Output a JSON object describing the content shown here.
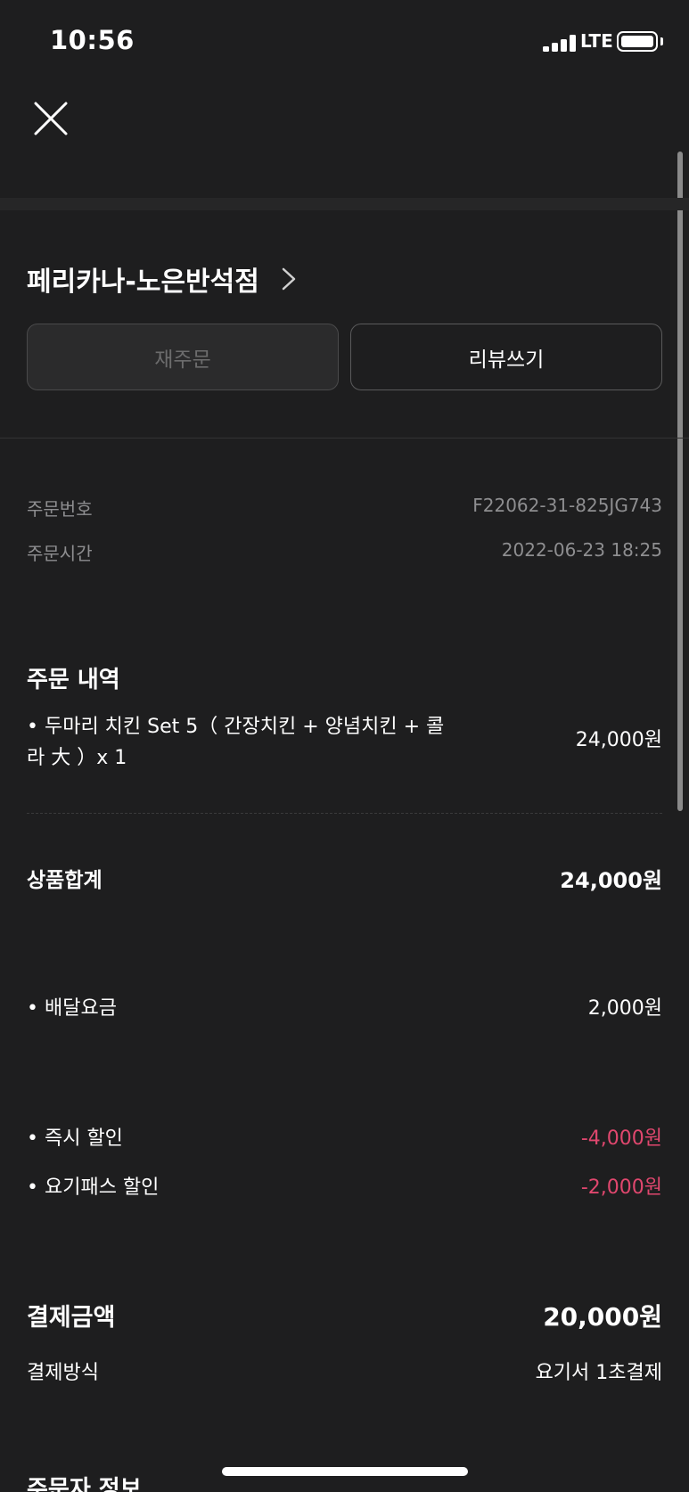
{
  "status_bar": {
    "time": "10:56",
    "network": "LTE",
    "signal_level": 4,
    "battery_level": 1.0
  },
  "icons": {
    "close": "close-icon",
    "chevron": "chevron-right-icon"
  },
  "store": {
    "name": "페리카나-노은반석점"
  },
  "actions": {
    "reorder_label": "재주문",
    "review_label": "리뷰쓰기"
  },
  "order_info": {
    "number_label": "주문번호",
    "number_value": "F22062-31-825JG743",
    "time_label": "주문시간",
    "time_value": "2022-06-23 18:25"
  },
  "order_details": {
    "title": "주문 내역",
    "items": [
      {
        "name": "• 두마리 치킨 Set 5（ 간장치킨 + 양념치킨 + 콜라 大 ）x 1",
        "price": "24,000원"
      }
    ]
  },
  "subtotal": {
    "label": "상품합계",
    "value": "24,000원"
  },
  "delivery_fee": {
    "label": "• 배달요금",
    "value": "2,000원"
  },
  "discounts": [
    {
      "label": "• 즉시 할인",
      "value": "-4,000원"
    },
    {
      "label": "• 요기패스 할인",
      "value": "-2,000원"
    }
  ],
  "payment": {
    "total_label": "결제금액",
    "total_value": "20,000원",
    "method_label": "결제방식",
    "method_value": "요기서 1초결제"
  },
  "next_section": {
    "title": "주문자 정보"
  },
  "colors": {
    "background": "#1e1e1f",
    "discount": "#e0476e",
    "muted": "#8e8e90"
  }
}
